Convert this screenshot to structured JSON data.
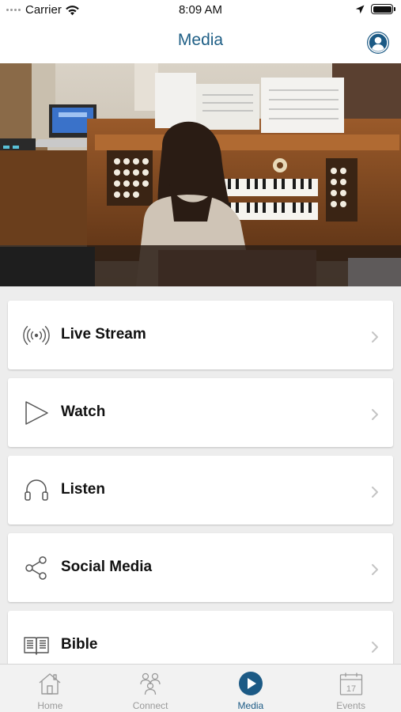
{
  "status_bar": {
    "carrier": "Carrier",
    "time": "8:09 AM"
  },
  "nav": {
    "title": "Media",
    "profile_icon": "person-circle-icon"
  },
  "hero": {
    "description_icon": "organ-player-photo"
  },
  "menu": [
    {
      "label": "Live Stream",
      "icon": "broadcast-icon"
    },
    {
      "label": "Watch",
      "icon": "play-outline-icon"
    },
    {
      "label": "Listen",
      "icon": "headphones-icon"
    },
    {
      "label": "Social Media",
      "icon": "share-icon"
    },
    {
      "label": "Bible",
      "icon": "book-icon"
    }
  ],
  "tabs": [
    {
      "label": "Home",
      "icon": "home-icon",
      "active": false
    },
    {
      "label": "Connect",
      "icon": "people-icon",
      "active": false
    },
    {
      "label": "Media",
      "icon": "play-circle-icon",
      "active": true
    },
    {
      "label": "Events",
      "icon": "calendar-icon",
      "active": false,
      "calendar_day": "17"
    }
  ],
  "colors": {
    "accent": "#1c5a85",
    "title": "#1f5f86",
    "inactive": "#9a9a9a",
    "background": "#ededed"
  }
}
